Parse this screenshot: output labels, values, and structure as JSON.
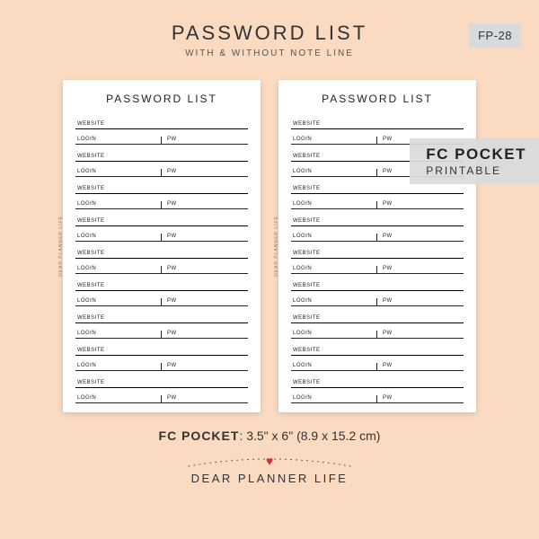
{
  "header": {
    "title": "PASSWORD LIST",
    "subtitle": "WITH & WITHOUT NOTE LINE",
    "sku": "FP-28"
  },
  "card": {
    "title": "PASSWORD LIST",
    "labels": {
      "website": "WEBSITE",
      "login": "LOGIN",
      "pw": "PW"
    },
    "side_label": "DEAR PLANNER LIFE",
    "entry_count": 9
  },
  "overlay": {
    "line1": "FC POCKET",
    "line2": "PRINTABLE"
  },
  "footer": {
    "size_label": "FC POCKET",
    "size_value": ": 3.5\" x 6\" (8.9 x 15.2 cm)",
    "brand": "DEAR PLANNER LIFE"
  }
}
